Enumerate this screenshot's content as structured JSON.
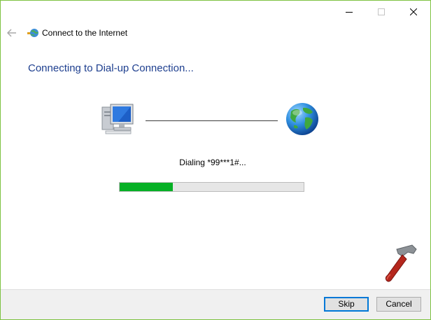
{
  "window": {
    "title": "Connect to the Internet",
    "controls": {
      "minimize_icon": "minimize-icon",
      "maximize_icon": "maximize-icon",
      "close_icon": "close-icon"
    }
  },
  "nav": {
    "back_icon": "back-arrow-icon"
  },
  "main": {
    "heading": "Connecting to Dial-up Connection...",
    "status": "Dialing *99***1#...",
    "progress_fraction": 0.29,
    "source_icon": "computer-icon",
    "target_icon": "globe-icon"
  },
  "footer": {
    "skip_label": "Skip",
    "cancel_label": "Cancel"
  },
  "colors": {
    "accent_border": "#7ec242",
    "heading": "#1e3f8f",
    "progress_fill": "#06b025",
    "default_button_border": "#0078d7"
  },
  "overlay": {
    "watermark_icon": "hammer-icon"
  }
}
